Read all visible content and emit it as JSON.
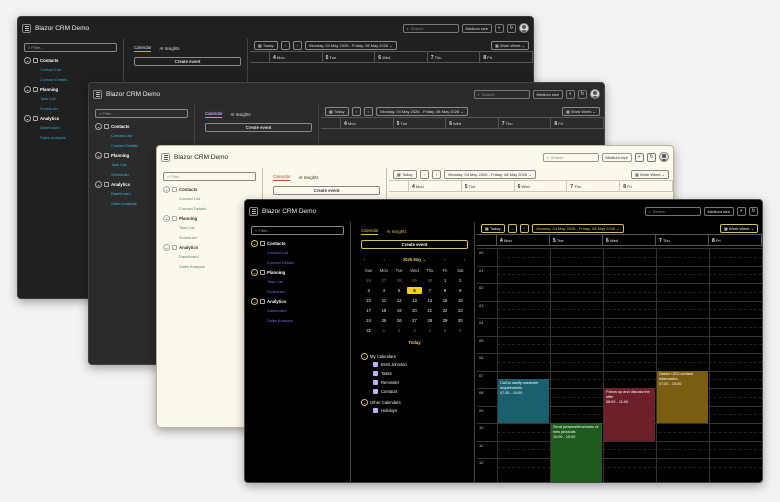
{
  "app": {
    "title": "Blazor CRM Demo"
  },
  "header": {
    "search_placeholder": "Search",
    "size_select": "Medium size"
  },
  "sidebar": {
    "filter_placeholder": "Filter...",
    "groups": [
      {
        "label": "Contacts",
        "items": [
          "Contact List",
          "Contact Details"
        ]
      },
      {
        "label": "Planning",
        "items": [
          "Task List",
          "Scheduler"
        ]
      },
      {
        "label": "Analytics",
        "items": [
          "Dashboard",
          "Sales Analysis"
        ]
      }
    ]
  },
  "middle": {
    "tabs": [
      "Calendar",
      "AI Insights"
    ],
    "create_event": "Create event",
    "mini_calendar": {
      "title": "2026 May",
      "weekdays": [
        "Sun",
        "Mon",
        "Tue",
        "Wed",
        "Thu",
        "Fri",
        "Sat"
      ],
      "days": [
        [
          "26",
          "27",
          "28",
          "29",
          "30",
          "1",
          "2"
        ],
        [
          "3",
          "4",
          "5",
          "6",
          "7",
          "8",
          "9"
        ],
        [
          "10",
          "11",
          "12",
          "13",
          "14",
          "15",
          "16"
        ],
        [
          "17",
          "18",
          "19",
          "20",
          "21",
          "22",
          "23"
        ],
        [
          "24",
          "25",
          "26",
          "27",
          "28",
          "29",
          "30"
        ],
        [
          "31",
          "1",
          "2",
          "3",
          "4",
          "5",
          "6"
        ]
      ],
      "today_day": "6",
      "today_button": "Today"
    },
    "my_calendars": {
      "label": "My Calendars",
      "items": [
        "Brett Johnson",
        "Tasks",
        "Reminder",
        "Contacts"
      ]
    },
    "other_calendars": {
      "label": "Other Calendars",
      "items": [
        "Holidays"
      ]
    }
  },
  "calendar": {
    "today_label": "Today",
    "range": "Monday, 04 May 2026 - Friday, 08 May 2026",
    "view": "Work Week",
    "days": [
      {
        "num": "4",
        "name": "Mon"
      },
      {
        "num": "5",
        "name": "Tue"
      },
      {
        "num": "6",
        "name": "Wed"
      },
      {
        "num": "7",
        "name": "Thu"
      },
      {
        "num": "8",
        "name": "Fri"
      }
    ],
    "hours": [
      "00",
      "01",
      "02",
      "03",
      "04",
      "05",
      "06",
      "07",
      "08",
      "09",
      "10",
      "11",
      "12"
    ],
    "events": [
      {
        "title": "Call to clarify customer requirements",
        "time": "07:30 - 10:00",
        "color": "#1a5f6e"
      },
      {
        "title": "Send pictures/brochures of new products",
        "time": "10:00 - 15:00",
        "color": "#1f5a1f"
      },
      {
        "title": "Follow up and discuss the offer",
        "time": "08:00 - 11:00",
        "color": "#6e1f2a"
      },
      {
        "title": "Obtain CEO contact information",
        "time": "07:00 - 10:00",
        "color": "#7a5d10"
      }
    ]
  },
  "colors": {
    "accent_gold": "#d6c060",
    "today_yellow": "#f5d020",
    "link_blue": "#4fc3f7",
    "link_violet": "#7b68ee"
  }
}
